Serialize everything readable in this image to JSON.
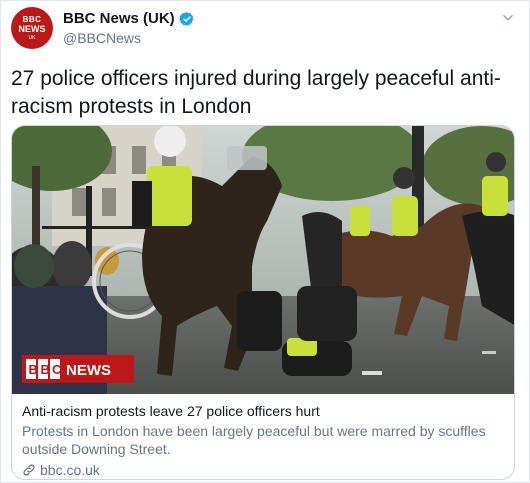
{
  "account": {
    "avatar_line1": "BBC",
    "avatar_line2": "NEWS",
    "avatar_line3": "UK",
    "display_name": "BBC News (UK)",
    "handle": "@BBCNews",
    "verified": true
  },
  "tweet": {
    "text": "27 police officers injured during largely peaceful anti-racism protests in London"
  },
  "card": {
    "image_logo_left": "BBC",
    "image_logo_right": "NEWS",
    "title": "Anti-racism protests leave 27 police officers hurt",
    "description": "Protests in London have been largely peaceful but were marred by scuffles outside Downing Street.",
    "link": "bbc.co.uk"
  },
  "icons": [
    "verified-badge-icon",
    "chevron-down-icon",
    "link-icon"
  ],
  "colors": {
    "brand": "#bb1919",
    "verified": "#1da1f2",
    "text": "#14171a",
    "muted": "#657786"
  }
}
